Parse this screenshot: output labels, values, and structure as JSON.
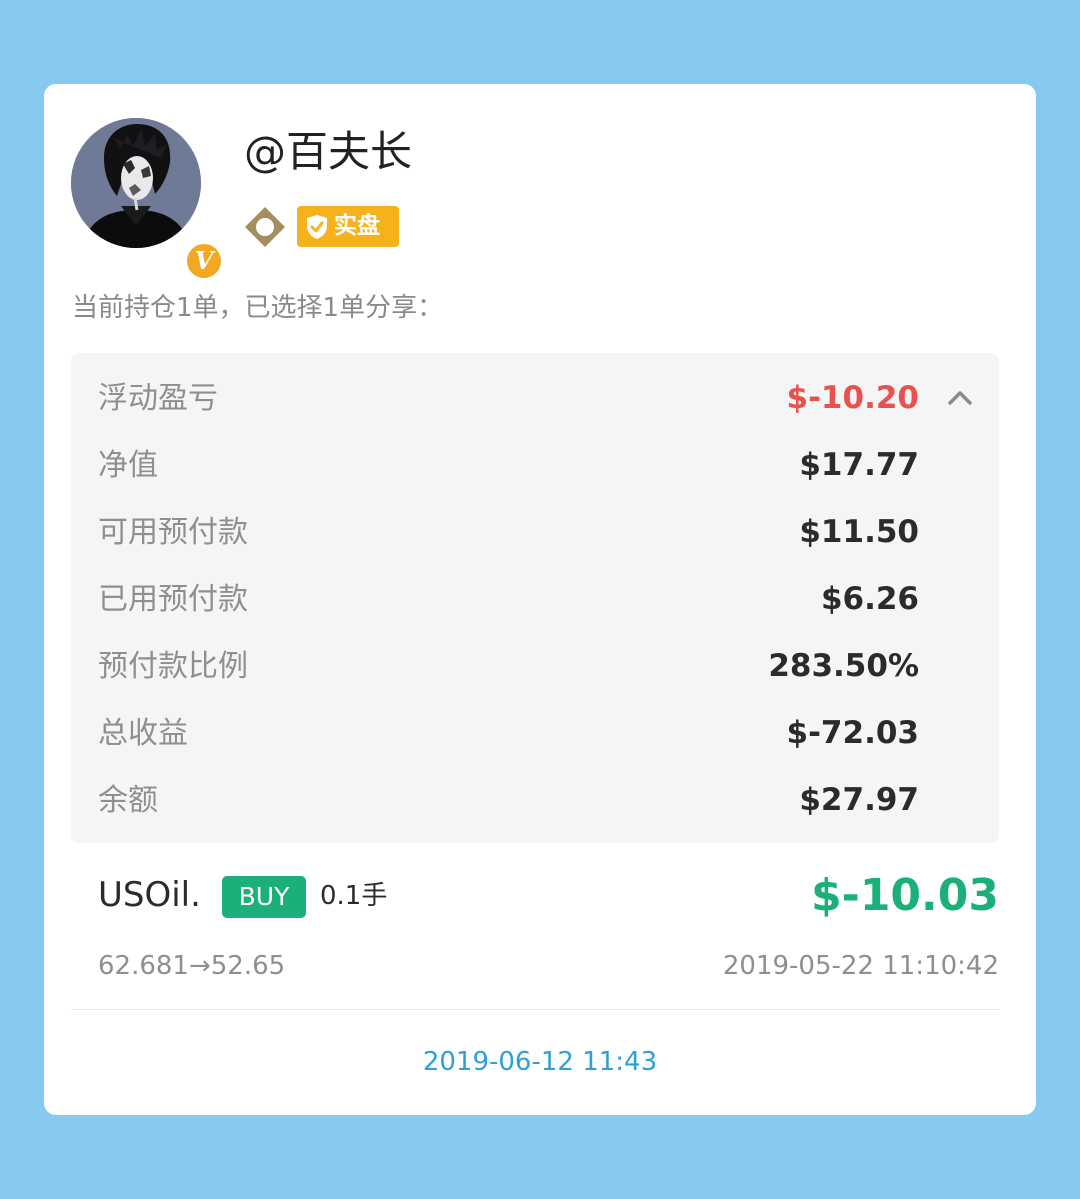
{
  "profile": {
    "username": "@百夫长",
    "avatar_icon": "user-avatar",
    "verified_icon": "verified-v-icon",
    "verified_mark": "V",
    "level_icon": "diamond-level-icon",
    "account_badge": "实盘",
    "account_badge_icon": "shield-check-icon"
  },
  "holding_info": "当前持仓1单，已选择1单分享：",
  "stats": {
    "rows": [
      {
        "label": "浮动盈亏",
        "value": "$-10.20",
        "status": "loss"
      },
      {
        "label": "净值",
        "value": "$17.77"
      },
      {
        "label": "可用预付款",
        "value": "$11.50"
      },
      {
        "label": "已用预付款",
        "value": "$6.26"
      },
      {
        "label": "预付款比例",
        "value": "283.50%"
      },
      {
        "label": "总收益",
        "value": "$-72.03"
      },
      {
        "label": "余额",
        "value": "$27.97"
      }
    ],
    "collapse_icon": "chevron-up-icon"
  },
  "order": {
    "symbol": "USOil.",
    "side": "BUY",
    "lots": "0.1手",
    "pnl": "$-10.03",
    "price_change": "62.681→52.65",
    "open_time": "2019-05-22 11:10:42"
  },
  "share_date": "2019-06-12 11:43",
  "colors": {
    "background": "#86cbef",
    "card": "#ffffff",
    "loss": "#e8514d",
    "profit": "#1bb07a",
    "buy_badge": "#1bb07a",
    "badge_gold": "#f6b21a",
    "date_link": "#2f9fd6"
  }
}
